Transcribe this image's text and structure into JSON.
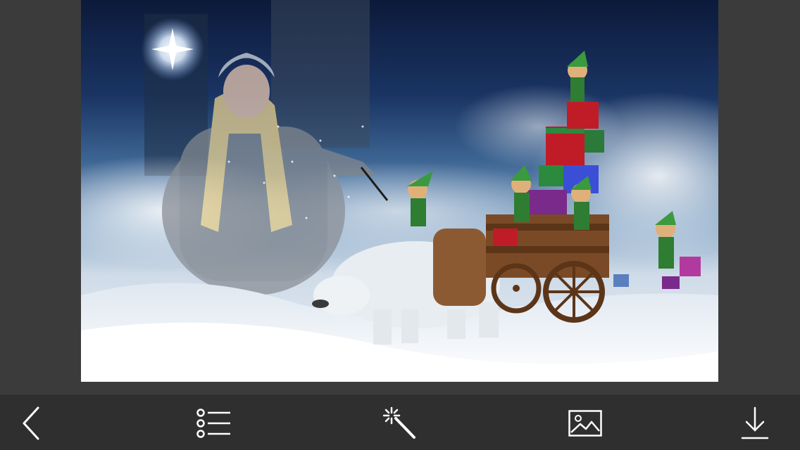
{
  "photo": {
    "description_icon": "photo-frame-christmas-elves-polar-bear"
  },
  "toolbar": {
    "items": [
      {
        "icon": "back-arrow-icon",
        "label": "Back"
      },
      {
        "icon": "list-icon",
        "label": "Frames"
      },
      {
        "icon": "magic-wand-icon",
        "label": "Effects"
      },
      {
        "icon": "image-icon",
        "label": "Gallery"
      },
      {
        "icon": "download-icon",
        "label": "Save"
      }
    ]
  },
  "colors": {
    "toolbar_bg": "#2f2f2f",
    "stage_bg": "#3b3b3b",
    "icon": "#ffffff"
  }
}
